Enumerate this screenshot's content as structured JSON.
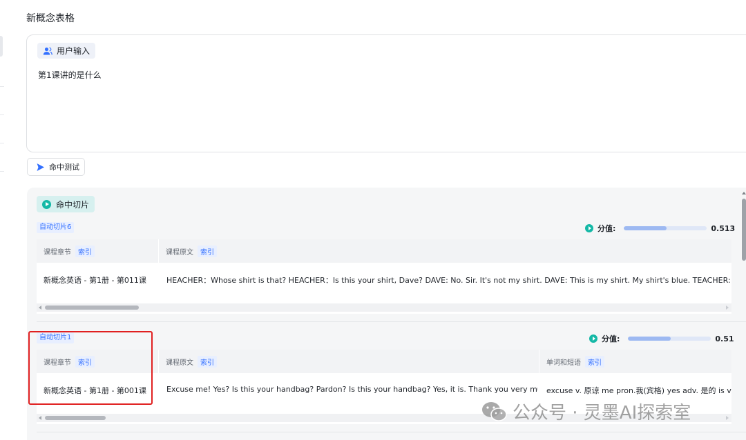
{
  "page": {
    "title": "新概念表格"
  },
  "input": {
    "chip_label": "用户输入",
    "query": "第1课讲的是什么"
  },
  "hit_button": {
    "label": "命中测试"
  },
  "results": {
    "chip_label": "命中切片",
    "slices": [
      {
        "tag": "自动切片6",
        "score_label": "分值:",
        "score_value": "0.513",
        "score_fraction": 0.513,
        "columns": [
          {
            "title": "课程章节",
            "sub": "索引"
          },
          {
            "title": "课程原文",
            "sub": "索引"
          }
        ],
        "row": [
          "新概念英语 - 第1册 - 第011课",
          "HEACHER：Whose shirt is that? HEACHER：Is this your shirt, Dave? DAVE: No. Sir. It's not my shirt. DAVE: This is my shirt. My shirt's blue. TEACHER: Is this s"
        ]
      },
      {
        "tag": "自动切片1",
        "score_label": "分值:",
        "score_value": "0.51",
        "score_fraction": 0.51,
        "columns": [
          {
            "title": "课程章节",
            "sub": "索引"
          },
          {
            "title": "课程原文",
            "sub": "索引"
          },
          {
            "title": "单词和短语",
            "sub": "索引"
          }
        ],
        "row": [
          "新概念英语 - 第1册 - 第001课",
          "Excuse me! Yes? Is this your handbag? Pardon? Is this your handbag? Yes, it is. Thank you very much.",
          "excuse v. 原谅 me pron.我(宾格) yes adv. 是的 is v."
        ]
      }
    ]
  },
  "watermark": {
    "text": "公众号 · 灵墨AI探索室"
  },
  "colors": {
    "accent": "#3370ff",
    "teal": "#14b8a6",
    "highlight": "#e02020"
  },
  "icons": [
    "user-icon",
    "play-triangle-icon",
    "play-circle-icon",
    "wechat-icon"
  ]
}
